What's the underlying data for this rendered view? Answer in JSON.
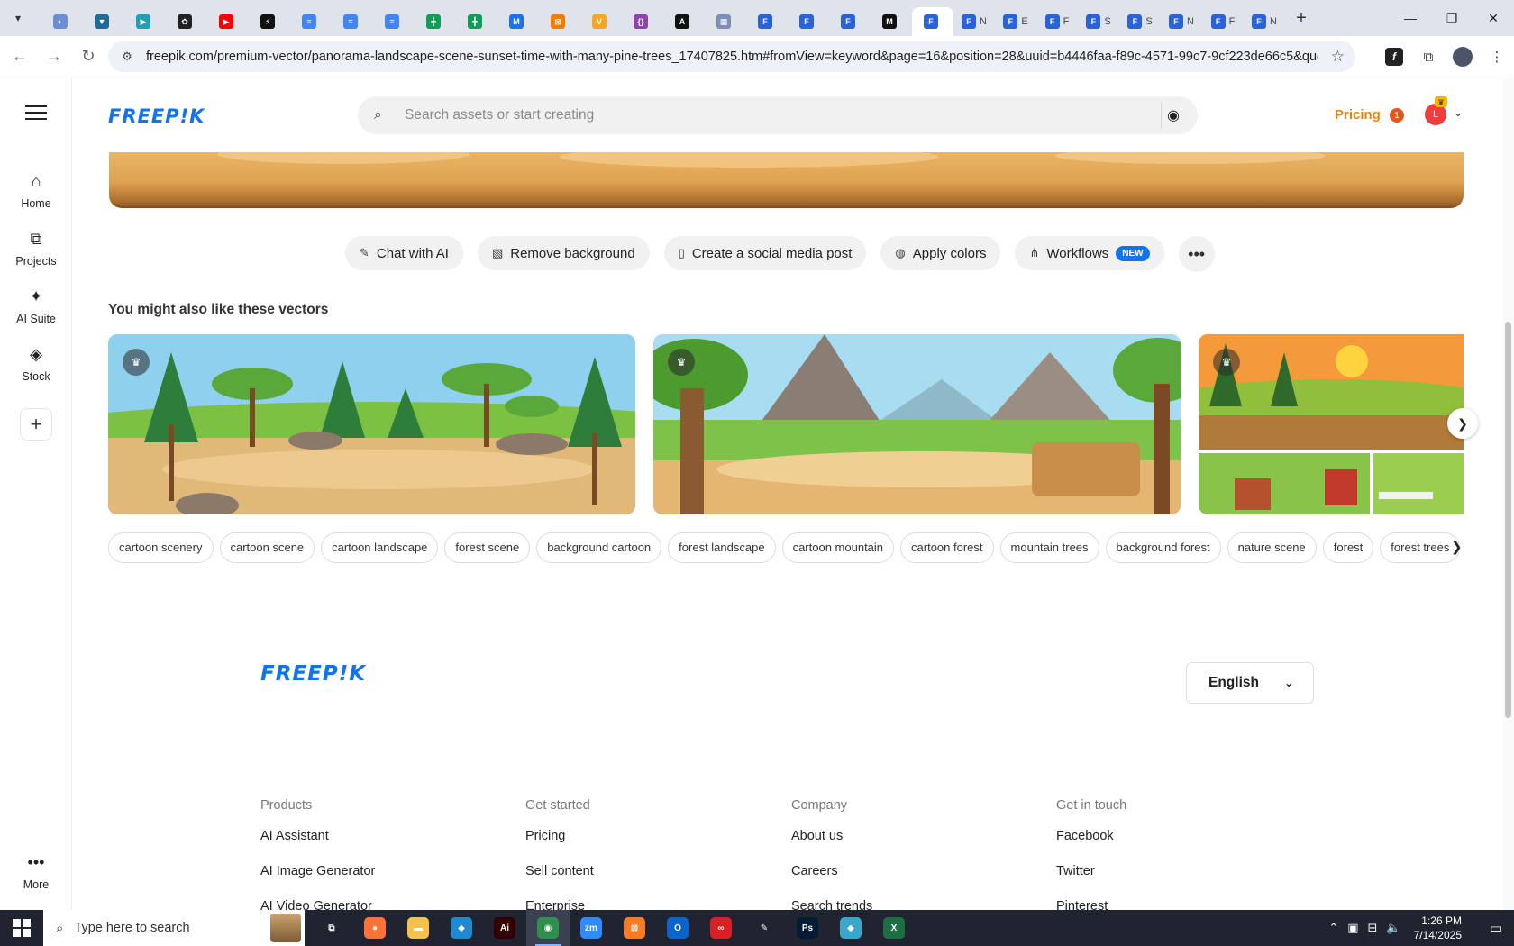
{
  "browser": {
    "tabs": [
      {
        "icon": "globe-icon",
        "color": "#6b8fd6",
        "glyph": "◐",
        "label": ""
      },
      {
        "icon": "shield-icon",
        "color": "#20699b",
        "glyph": "▼",
        "label": ""
      },
      {
        "icon": "arrow-icon",
        "color": "#1fa0b8",
        "glyph": "▶",
        "label": ""
      },
      {
        "icon": "openai-icon",
        "color": "#222222",
        "glyph": "✿",
        "label": ""
      },
      {
        "icon": "youtube-icon",
        "color": "#ff0000",
        "glyph": "▶",
        "label": ""
      },
      {
        "icon": "bolt-icon",
        "color": "#111111",
        "glyph": "⚡",
        "label": ""
      },
      {
        "icon": "docs-icon",
        "color": "#4285f4",
        "glyph": "≡",
        "label": ""
      },
      {
        "icon": "docs-icon",
        "color": "#4285f4",
        "glyph": "≡",
        "label": ""
      },
      {
        "icon": "docs-icon",
        "color": "#4285f4",
        "glyph": "≡",
        "label": ""
      },
      {
        "icon": "sheets-icon",
        "color": "#0f9d58",
        "glyph": "╋",
        "label": ""
      },
      {
        "icon": "sheets-icon",
        "color": "#0f9d58",
        "glyph": "╋",
        "label": ""
      },
      {
        "icon": "mb-icon",
        "color": "#1a73e8",
        "glyph": "M",
        "label": ""
      },
      {
        "icon": "app-icon",
        "color": "#f57c00",
        "glyph": "⊠",
        "label": ""
      },
      {
        "icon": "vee-icon",
        "color": "#f6a623",
        "glyph": "V",
        "label": ""
      },
      {
        "icon": "brackets-icon",
        "color": "#8e44ad",
        "glyph": "{}",
        "label": ""
      },
      {
        "icon": "ai-icon",
        "color": "#111111",
        "glyph": "A",
        "label": ""
      },
      {
        "icon": "grid-icon",
        "color": "#7b8fb8",
        "glyph": "▦",
        "label": ""
      },
      {
        "icon": "forms-icon",
        "color": "#2a62d8",
        "glyph": "F",
        "label": ""
      },
      {
        "icon": "forms-icon",
        "color": "#2a62d8",
        "glyph": "F",
        "label": ""
      },
      {
        "icon": "forms-icon",
        "color": "#2a62d8",
        "glyph": "F",
        "label": ""
      },
      {
        "icon": "m-icon",
        "color": "#111111",
        "glyph": "M",
        "label": ""
      },
      {
        "icon": "forms-icon",
        "color": "#2a62d8",
        "glyph": "F",
        "label": "",
        "active": true
      },
      {
        "icon": "forms-icon",
        "color": "#2a62d8",
        "glyph": "F",
        "label": "N"
      },
      {
        "icon": "forms-icon",
        "color": "#2a62d8",
        "glyph": "F",
        "label": "E"
      },
      {
        "icon": "forms-icon",
        "color": "#2a62d8",
        "glyph": "F",
        "label": "F"
      },
      {
        "icon": "forms-icon",
        "color": "#2a62d8",
        "glyph": "F",
        "label": "S"
      },
      {
        "icon": "forms-icon",
        "color": "#2a62d8",
        "glyph": "F",
        "label": "S"
      },
      {
        "icon": "forms-icon",
        "color": "#2a62d8",
        "glyph": "F",
        "label": "N"
      },
      {
        "icon": "forms-icon",
        "color": "#2a62d8",
        "glyph": "F",
        "label": "F"
      },
      {
        "icon": "forms-icon",
        "color": "#2a62d8",
        "glyph": "F",
        "label": "N"
      }
    ],
    "url": "freepik.com/premium-vector/panorama-landscape-scene-sunset-time-with-many-pine-trees_17407825.htm#fromView=keyword&page=16&position=28&uuid=b4446faa-f89c-4571-99c7-9cf223de66c5&query..."
  },
  "freepik": {
    "logo": "FREEP!K",
    "sidebar": [
      {
        "label": "Home",
        "icon": "home-icon"
      },
      {
        "label": "Projects",
        "icon": "projects-icon"
      },
      {
        "label": "AI Suite",
        "icon": "sparkle-icon"
      },
      {
        "label": "Stock",
        "icon": "stock-icon"
      }
    ],
    "more_label": "More",
    "search_placeholder": "Search assets or start creating",
    "pricing": "Pricing",
    "notification_count": "1",
    "tools": [
      {
        "label": "Chat with AI",
        "icon": "chat-ai-icon"
      },
      {
        "label": "Remove background",
        "icon": "remove-bg-icon"
      },
      {
        "label": "Create a social media post",
        "icon": "phone-icon"
      },
      {
        "label": "Apply colors",
        "icon": "palette-icon"
      },
      {
        "label": "Workflows",
        "icon": "workflow-icon",
        "badge": "NEW"
      }
    ],
    "section_title": "You might also like these vectors",
    "tags": [
      "cartoon scenery",
      "cartoon scene",
      "cartoon landscape",
      "forest scene",
      "background cartoon",
      "forest landscape",
      "cartoon mountain",
      "cartoon forest",
      "mountain trees",
      "background forest",
      "nature scene",
      "forest",
      "forest trees"
    ],
    "language": "English",
    "footer": {
      "columns": [
        {
          "heading": "Products",
          "links": [
            "AI Assistant",
            "AI Image Generator",
            "AI Video Generator"
          ]
        },
        {
          "heading": "Get started",
          "links": [
            "Pricing",
            "Sell content",
            "Enterprise"
          ]
        },
        {
          "heading": "Company",
          "links": [
            "About us",
            "Careers",
            "Search trends"
          ]
        },
        {
          "heading": "Get in touch",
          "links": [
            "Facebook",
            "Twitter",
            "Pinterest"
          ]
        }
      ]
    }
  },
  "taskbar": {
    "search_placeholder": "Type here to search",
    "time": "1:26 PM",
    "date": "7/14/2025",
    "apps": [
      {
        "icon": "task-view-icon",
        "color": "#1f2430",
        "glyph": "⧉"
      },
      {
        "icon": "firefox-icon",
        "color": "#ff7139",
        "glyph": "●"
      },
      {
        "icon": "file-explorer-icon",
        "color": "#f2c14e",
        "glyph": "▬"
      },
      {
        "icon": "vscode-icon",
        "color": "#1f8ad2",
        "glyph": "◆"
      },
      {
        "icon": "illustrator-icon",
        "color": "#330000",
        "glyph": "Ai"
      },
      {
        "icon": "chrome-icon",
        "color": "#2f8f4e",
        "glyph": "◉",
        "active": true
      },
      {
        "icon": "zoom-icon",
        "color": "#2d8cff",
        "glyph": "zm"
      },
      {
        "icon": "xampp-icon",
        "color": "#fb7a24",
        "glyph": "⊠"
      },
      {
        "icon": "outlook-icon",
        "color": "#0a64c9",
        "glyph": "O"
      },
      {
        "icon": "creative-cloud-icon",
        "color": "#da1f26",
        "glyph": "∞"
      },
      {
        "icon": "pen-icon",
        "color": "#1f2430",
        "glyph": "✎"
      },
      {
        "icon": "photoshop-icon",
        "color": "#001d34",
        "glyph": "Ps"
      },
      {
        "icon": "gem-icon",
        "color": "#3aa6c9",
        "glyph": "◆"
      },
      {
        "icon": "excel-icon",
        "color": "#1d6f42",
        "glyph": "X"
      }
    ]
  }
}
